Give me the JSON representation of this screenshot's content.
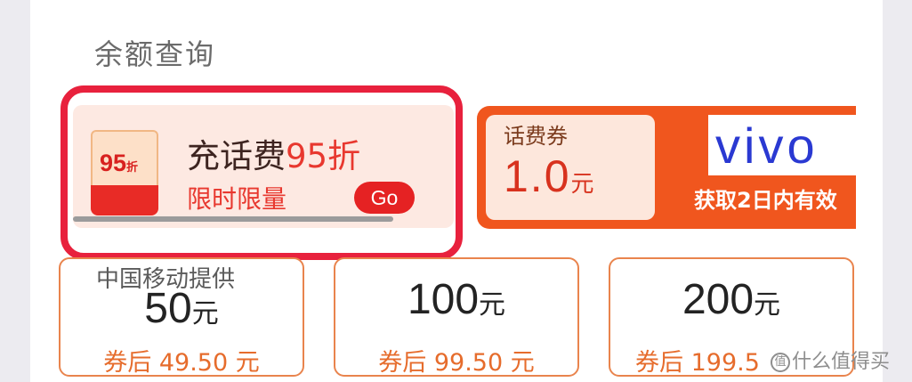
{
  "section": {
    "title": "余额查询"
  },
  "promo": {
    "badge_number": "95",
    "badge_suffix": "折",
    "title_prefix": "充话费",
    "title_highlight": "95折",
    "subtitle": "限时限量",
    "go_label": "Go"
  },
  "voucher": {
    "label": "话费券",
    "amount": "1.0",
    "unit": "元",
    "brand": "vivo",
    "note": "获取2日内有效"
  },
  "options": [
    {
      "provider": "中国移动提供",
      "amount": "50",
      "unit": "元",
      "price": "券后 49.50 元"
    },
    {
      "amount": "100",
      "unit": "元",
      "price": "券后 99.50 元"
    },
    {
      "amount": "200",
      "unit": "元",
      "price": "券后 199.5"
    }
  ],
  "watermark": {
    "icon": "值",
    "text": "什么值得买"
  },
  "colors": {
    "accent_red": "#e8213d",
    "voucher_orange": "#f0561e",
    "option_border": "#e9844d",
    "vivo_blue": "#2a39d2"
  }
}
